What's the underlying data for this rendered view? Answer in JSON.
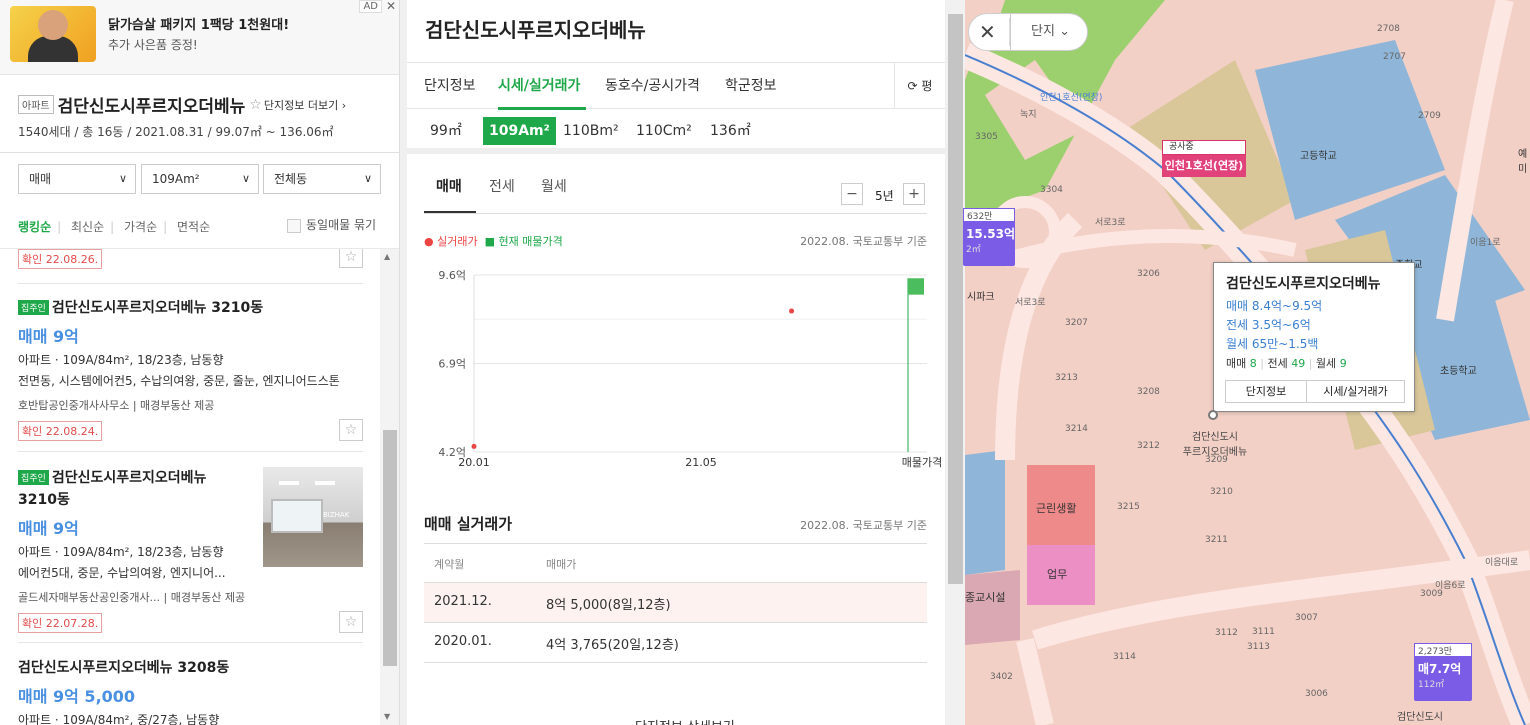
{
  "ad": {
    "line1": "닭가슴살 패키지 1팩당 1천원대!",
    "line2": "추가 사은품 증정!",
    "badge": "AD",
    "close": "✕"
  },
  "complex": {
    "type": "아파트",
    "name": "검단신도시푸르지오더베뉴",
    "more": "단지정보 더보기 ›",
    "info": "1540세대 / 총 16동 / 2021.08.31 / 99.07㎡ ~ 136.06㎡"
  },
  "filters": {
    "trade": "매매",
    "area": "109Am²",
    "dong": "전체동"
  },
  "sorts": {
    "ranking": "랭킹순",
    "latest": "최신순",
    "price": "가격순",
    "area": "면적순",
    "group": "동일매물 묶기"
  },
  "listings": [
    {
      "confirm": "확인 22.08.26."
    },
    {
      "owner": "집주인",
      "name": "검단신도시푸르지오더베뉴 3210동",
      "price": "매매 9억",
      "spec": "아파트 · 109A/84m², 18/23층, 남동향",
      "desc": "전면동, 시스템에어컨5, 수납의여왕, 중문, 줄눈, 엔지니어드스톤",
      "agent": "호반탑공인중개사사무소 | 매경부동산 제공",
      "confirm": "확인 22.08.24."
    },
    {
      "owner": "집주인",
      "name1": "검단신도시푸르지오더베뉴",
      "name2": "3210동",
      "price": "매매 9억",
      "spec": "아파트 · 109A/84m², 18/23층, 남동향",
      "desc": "에어컨5대, 중문, 수납의여왕, 엔지니어...",
      "agent": "골드세자매부동산공인중개사... | 매경부동산 제공",
      "confirm": "확인 22.07.28.",
      "thumb_text": "BIZHAK"
    },
    {
      "name": "검단신도시푸르지오더베뉴 3208동",
      "price": "매매 9억 5,000",
      "spec": "아파트 · 109A/84m², 중/27층, 남동향"
    }
  ],
  "detail": {
    "title": "검단신도시푸르지오더베뉴",
    "tabs": [
      "단지정보",
      "시세/실거래가",
      "동호수/공시가격",
      "학군정보"
    ],
    "pyeong": "⟳ 평",
    "sizes": [
      "99㎡",
      "109Am²",
      "110Bm²",
      "110Cm²",
      "136㎡"
    ],
    "subtabs": [
      "매매",
      "전세",
      "월세"
    ],
    "years": "5년",
    "legend_real": "● 실거래가",
    "legend_cur": "■ 현재 매물가격",
    "source": "2022.08. 국토교통부 기준",
    "table_title": "매매 실거래가",
    "table_source": "2022.08. 국토교통부 기준",
    "col_month": "계약월",
    "col_price": "매매가",
    "rows": [
      {
        "month": "2021.12.",
        "price": "8억 5,000(8일,12층)"
      },
      {
        "month": "2020.01.",
        "price": "4억 3,765(20일,12층)"
      }
    ],
    "more": "단지정보 상세보기"
  },
  "chart_data": {
    "type": "scatter",
    "ylim": [
      4.2,
      9.6
    ],
    "y_ticks": [
      "9.6억",
      "6.9억",
      "4.2억"
    ],
    "x_ticks": [
      "20.01",
      "21.05",
      "매물가격"
    ],
    "series": [
      {
        "name": "실거래가",
        "points": [
          {
            "x": "2020.01",
            "y": 4.37
          },
          {
            "x": "2021.12",
            "y": 8.5
          }
        ]
      },
      {
        "name": "현재 매물가격",
        "range": [
          9.0,
          9.5
        ]
      }
    ]
  },
  "map": {
    "filter": "단지",
    "popup": {
      "name": "검단신도시푸르지오더베뉴",
      "sale": "매매 8.4억~9.5억",
      "jeonse": "전세 3.5억~6억",
      "monthly": "월세 65만~1.5백",
      "counts_sale": "매매",
      "n_sale": "8",
      "counts_jeonse": "전세",
      "n_jeonse": "49",
      "counts_monthly": "월세",
      "n_monthly": "9",
      "btn1": "단지정보",
      "btn2": "시세/실거래가"
    },
    "construction": {
      "tag": "공사중",
      "name": "인천1호선(연장)"
    },
    "marker_left": {
      "top": "632만",
      "price": "15.53억",
      "area": "2㎡"
    },
    "marker_bottom": {
      "top": "2,273만",
      "price": "매7.7억",
      "area": "112㎡"
    },
    "labels": {
      "green": "녹지",
      "school1": "고등학교",
      "school2": "중학교",
      "school3": "초등학교",
      "biz1": "근린생활",
      "biz2": "업무",
      "religion": "종교시설",
      "road1": "서로3로",
      "road2": "이음1로",
      "road3": "이음6로",
      "road4": "이음대로",
      "road5": "서로3로",
      "complex": "검단신도시\n푸르지오더베뉴",
      "complex_num": "3209",
      "park": "시파크",
      "rail": "인천1호선(연장)",
      "bottom_complex": "검단신도시",
      "e": "예미"
    },
    "lots": [
      "3305",
      "3304",
      "3206",
      "3207",
      "3213",
      "3208",
      "3214",
      "3212",
      "3215",
      "3211",
      "3210",
      "3111",
      "3112",
      "3114",
      "3113",
      "3007",
      "3006",
      "3009",
      "2708",
      "2707",
      "2709",
      "3402"
    ]
  }
}
